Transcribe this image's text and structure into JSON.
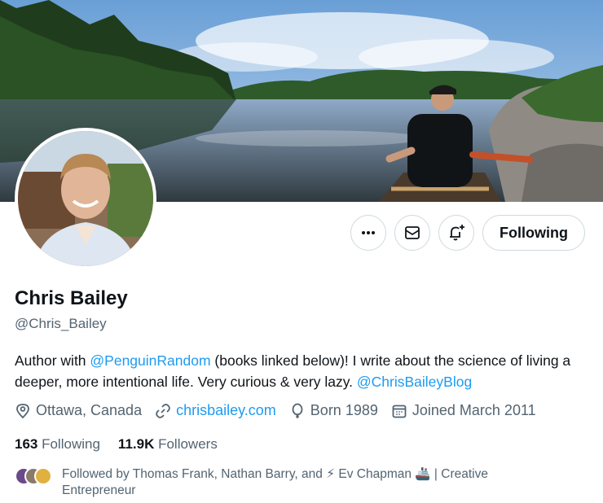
{
  "profile": {
    "name": "Chris Bailey",
    "handle": "@Chris_Bailey",
    "bio": {
      "part1": "Author with ",
      "mention1": "@PenguinRandom",
      "part2": " (books linked below)! I write about the science of living a deeper, more intentional life. Very curious & very lazy. ",
      "mention2": "@ChrisBaileyBlog"
    },
    "location": "Ottawa, Canada",
    "website": "chrisbailey.com",
    "born": "Born 1989",
    "joined": "Joined March 2011"
  },
  "stats": {
    "following_count": "163",
    "following_label": " Following",
    "followers_count": "11.9K",
    "followers_label": " Followers"
  },
  "actions": {
    "more_icon": "more-icon",
    "message_icon": "mail-icon",
    "notify_icon": "bell-plus-icon",
    "follow_label": "Following"
  },
  "followed_by": {
    "text": "Followed by Thomas Frank, Nathan Barry, and ⚡ Ev Chapman 🚢 | Creative Entrepreneur"
  },
  "colors": {
    "accent": "#1d9bf0",
    "text": "#0f1419",
    "secondary": "#536471",
    "border": "#cfd9de"
  }
}
